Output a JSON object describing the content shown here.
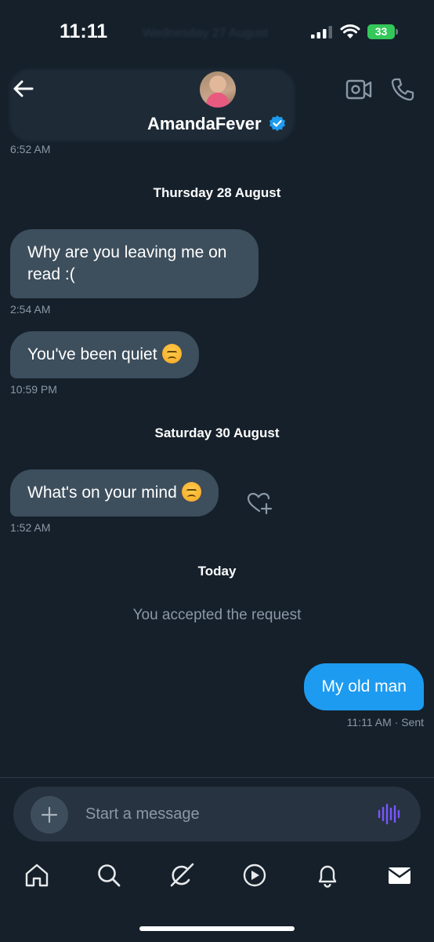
{
  "status_bar": {
    "time": "11:11",
    "ghost_date": "Wednesday 27 August",
    "battery": "33"
  },
  "header": {
    "contact_name": "AmandaFever",
    "verified": true
  },
  "colors": {
    "background": "#15202b",
    "incoming_bubble": "#3d4e5c",
    "outgoing_bubble": "#1d9bf0",
    "verified_badge": "#1d9bf0",
    "voice_accent": "#7856ff"
  },
  "messages": {
    "t0": "6:52 AM",
    "d1": "Thursday 28 August",
    "m1": {
      "text": "Why are you leaving me on read :(",
      "time": "2:54 AM"
    },
    "m2": {
      "text": "You've been quiet",
      "emoji": "persevering-face",
      "time": "10:59 PM"
    },
    "d2": "Saturday 30 August",
    "m3": {
      "text": "What's on your mind",
      "emoji": "persevering-face",
      "time": "1:52 AM"
    },
    "d3": "Today",
    "system": "You accepted the request",
    "m4": {
      "text": "My old man",
      "time": "11:11 AM",
      "status": "· Sent"
    }
  },
  "composer": {
    "placeholder": "Start a message"
  },
  "tabs": [
    "home-icon",
    "search-icon",
    "grok-icon",
    "video-play-icon",
    "bell-icon",
    "mail-icon"
  ]
}
